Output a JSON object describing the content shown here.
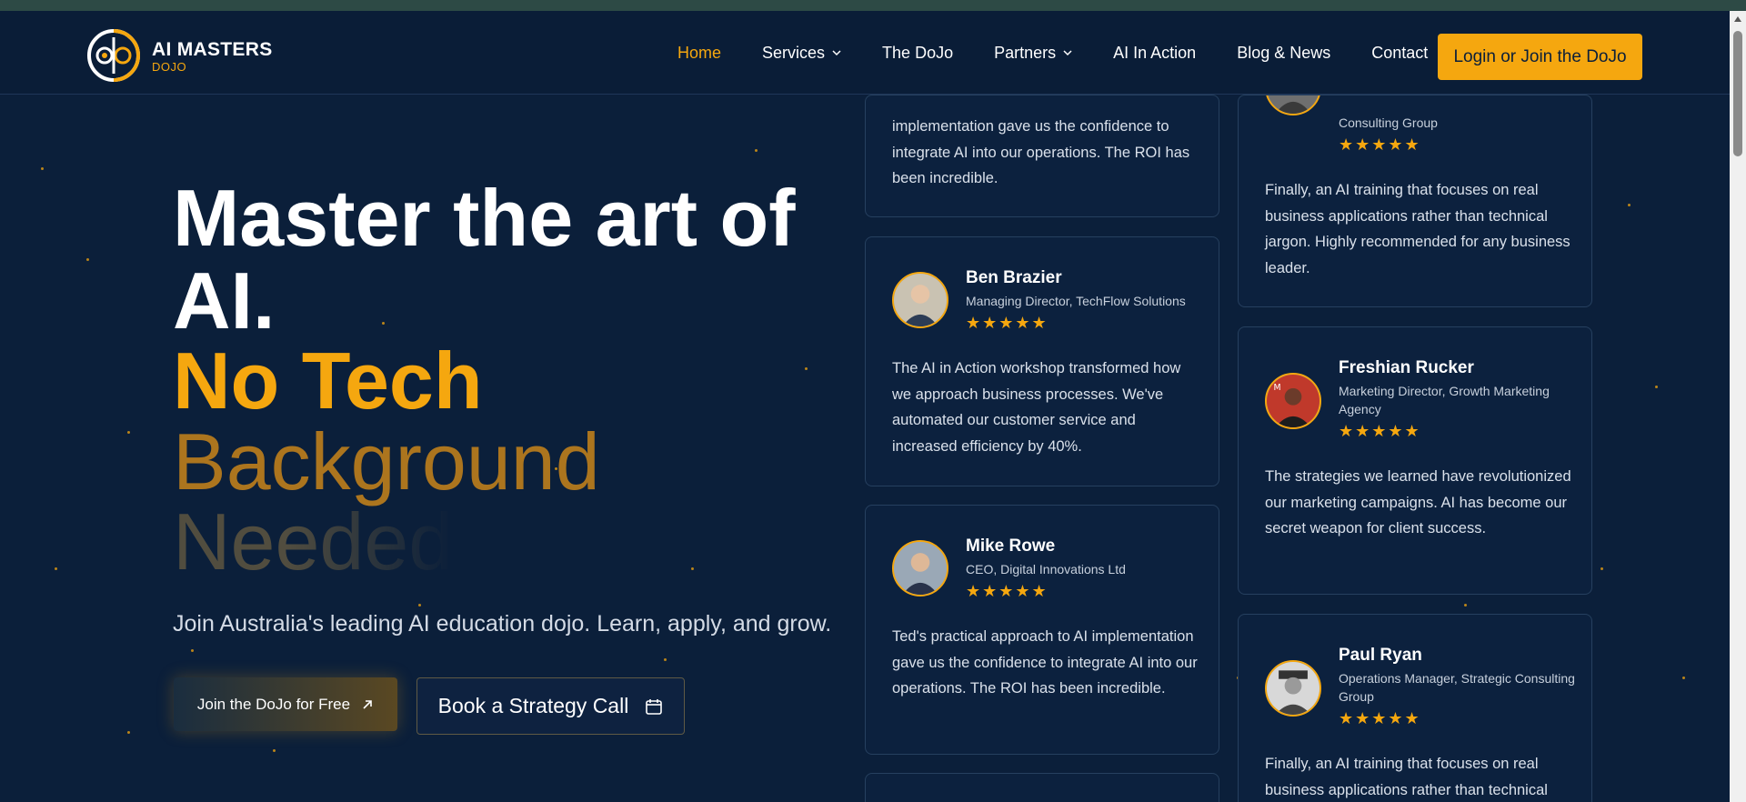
{
  "header": {
    "logo_title": "AI MASTERS",
    "logo_sub": "DOJO",
    "nav": [
      {
        "label": "Home",
        "active": true
      },
      {
        "label": "Services",
        "dropdown": true
      },
      {
        "label": "The DoJo"
      },
      {
        "label": "Partners",
        "dropdown": true
      },
      {
        "label": "AI In Action"
      },
      {
        "label": "Blog & News"
      },
      {
        "label": "Contact"
      }
    ],
    "login_label": "Login or Join the DoJo"
  },
  "hero": {
    "line1": "Master the art of",
    "line2": "AI.",
    "line3": "No Tech",
    "line4": "Background",
    "line5": "Needed",
    "subtitle": "Join Australia's leading AI education dojo. Learn, apply, and grow.",
    "cta_primary": "Join the DoJo for Free",
    "cta_secondary": "Book a Strategy Call"
  },
  "testimonials": {
    "col1": [
      {
        "name": "",
        "role": "",
        "stars": "",
        "quote": "implementation gave us the confidence to integrate AI into our operations. The ROI has been incredible."
      },
      {
        "name": "Ben Brazier",
        "role": "Managing Director, TechFlow Solutions",
        "stars": "★★★★★",
        "quote": "The AI in Action workshop transformed how we approach business processes. We've automated our customer service and increased efficiency by 40%."
      },
      {
        "name": "Mike Rowe",
        "role": "CEO, Digital Innovations Ltd",
        "stars": "★★★★★",
        "quote": "Ted's practical approach to AI implementation gave us the confidence to integrate AI into our operations. The ROI has been incredible."
      }
    ],
    "col2": [
      {
        "name": "",
        "role": "Consulting Group",
        "stars": "★★★★★",
        "quote": "Finally, an AI training that focuses on real business applications rather than technical jargon. Highly recommended for any business leader."
      },
      {
        "name": "Freshian Rucker",
        "role": "Marketing Director, Growth Marketing Agency",
        "stars": "★★★★★",
        "quote": "The strategies we learned have revolutionized our marketing campaigns. AI has become our secret weapon for client success."
      },
      {
        "name": "Paul Ryan",
        "role": "Operations Manager, Strategic Consulting Group",
        "stars": "★★★★★",
        "quote": "Finally, an AI training that focuses on real business applications rather than technical"
      }
    ]
  },
  "colors": {
    "background": "#0b1f3a",
    "accent": "#f5a70f",
    "card_border": "#26405f"
  }
}
